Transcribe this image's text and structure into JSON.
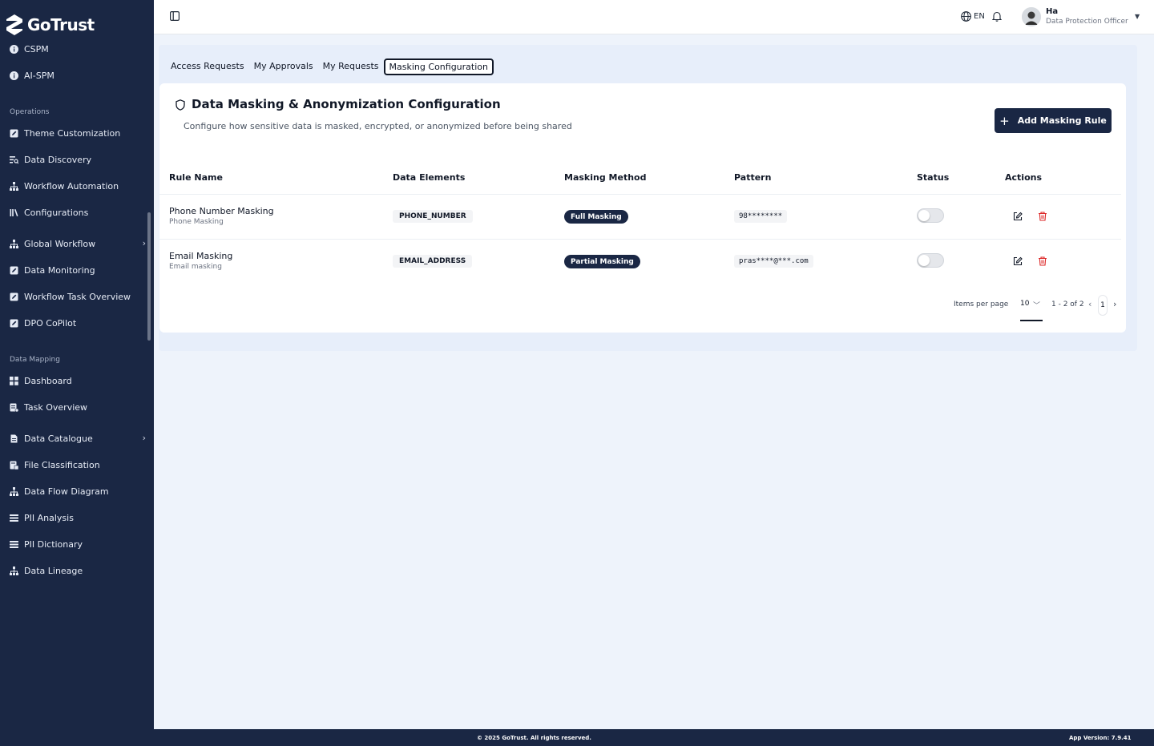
{
  "brand": {
    "name": "GoTrust"
  },
  "sidebar": {
    "top_items": [
      {
        "label": "CSPM",
        "icon": "info-icon"
      },
      {
        "label": "AI-SPM",
        "icon": "info-icon"
      }
    ],
    "sections": [
      {
        "title": "Operations",
        "items": [
          {
            "label": "Theme Customization",
            "icon": "edit-square-icon",
            "chevron": false
          },
          {
            "label": "Data Discovery",
            "icon": "list-search-icon",
            "chevron": false
          },
          {
            "label": "Workflow Automation",
            "icon": "hierarchy-icon",
            "chevron": false
          },
          {
            "label": "Configurations",
            "icon": "library-icon",
            "chevron": false
          },
          {
            "label": "Global Workflow",
            "icon": "hierarchy-icon",
            "chevron": true
          },
          {
            "label": "Data Monitoring",
            "icon": "edit-square-icon",
            "chevron": false
          },
          {
            "label": "Workflow Task Overview",
            "icon": "edit-square-icon",
            "chevron": false
          },
          {
            "label": "DPO CoPilot",
            "icon": "edit-square-icon",
            "chevron": false
          }
        ]
      },
      {
        "title": "Data Mapping",
        "items": [
          {
            "label": "Dashboard",
            "icon": "grid-icon",
            "chevron": false
          },
          {
            "label": "Task Overview",
            "icon": "task-list-icon",
            "chevron": false
          },
          {
            "label": "Data Catalogue",
            "icon": "document-icon",
            "chevron": true
          },
          {
            "label": "File Classification",
            "icon": "file-grid-icon",
            "chevron": false
          },
          {
            "label": "Data Flow Diagram",
            "icon": "hierarchy-icon",
            "chevron": false
          },
          {
            "label": "PII Analysis",
            "icon": "list-icon",
            "chevron": false
          },
          {
            "label": "PII Dictionary",
            "icon": "list-icon",
            "chevron": false
          },
          {
            "label": "Data Lineage",
            "icon": "hierarchy-icon",
            "chevron": false
          }
        ]
      }
    ]
  },
  "header": {
    "language": "EN",
    "user": {
      "name": "Ha",
      "role": "Data Protection Officer"
    }
  },
  "tabs": [
    {
      "label": "Access Requests",
      "active": false
    },
    {
      "label": "My Approvals",
      "active": false
    },
    {
      "label": "My Requests",
      "active": false
    },
    {
      "label": "Masking Configuration",
      "active": true
    }
  ],
  "card": {
    "title": "Data Masking & Anonymization Configuration",
    "description": "Configure how sensitive data is masked, encrypted, or anonymized before being shared",
    "add_button": "Add Masking Rule"
  },
  "table": {
    "columns": [
      "Rule Name",
      "Data Elements",
      "Masking Method",
      "Pattern",
      "Status",
      "Actions"
    ],
    "rows": [
      {
        "name": "Phone Number Masking",
        "subtitle": "Phone Masking",
        "element": "PHONE_NUMBER",
        "method": "Full Masking",
        "pattern": "98********",
        "enabled": false
      },
      {
        "name": "Email Masking",
        "subtitle": "Email masking",
        "element": "EMAIL_ADDRESS",
        "method": "Partial Masking",
        "pattern": "pras****@***.com",
        "enabled": false
      }
    ]
  },
  "pagination": {
    "items_per_page_label": "Items per page",
    "items_per_page": "10",
    "range": "1 - 2 of 2",
    "page": "1"
  },
  "footer": {
    "copyright": "© 2025 GoTrust. All rights reserved.",
    "version": "App Version: 7.9.41"
  },
  "colors": {
    "navy": "#1a2744",
    "danger": "#dc2626",
    "page_bg": "#eef3fb"
  }
}
